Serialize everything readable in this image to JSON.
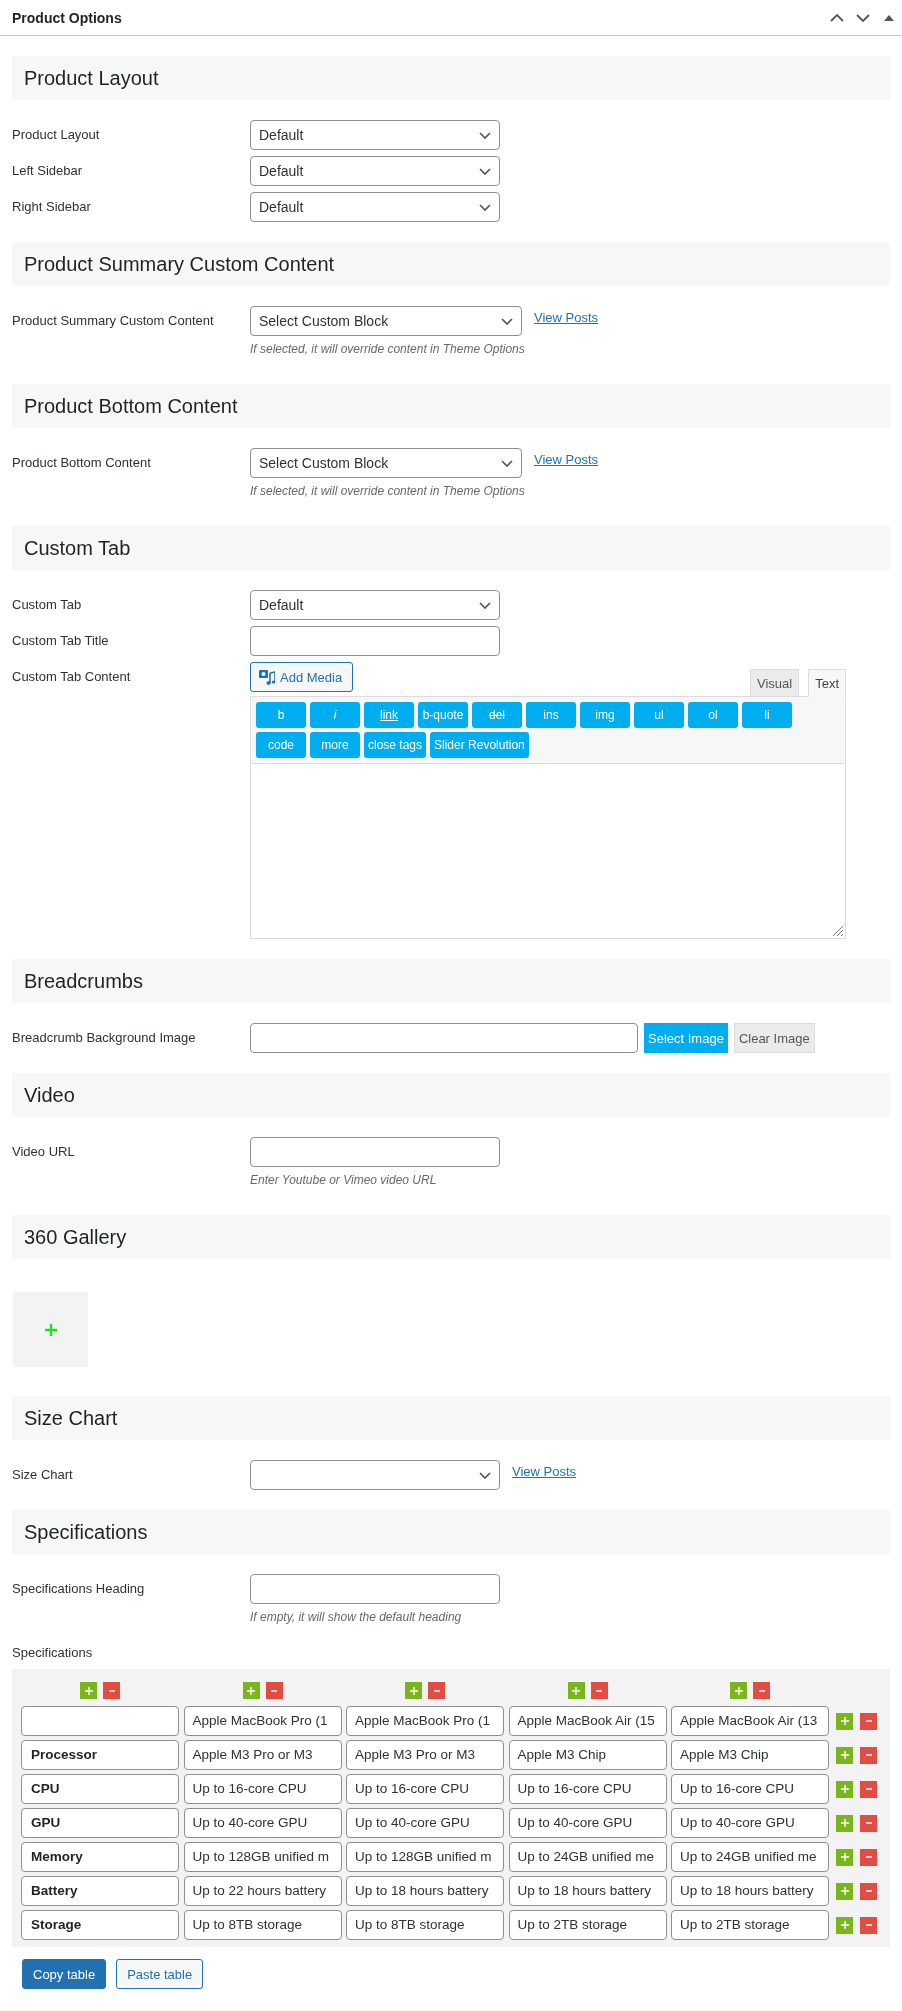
{
  "panel": {
    "title": "Product Options"
  },
  "sections": [
    {
      "title": "Product Layout",
      "fields": [
        {
          "kind": "select",
          "label": "Product Layout",
          "value": "Default"
        },
        {
          "kind": "select",
          "label": "Left Sidebar",
          "value": "Default"
        },
        {
          "kind": "select",
          "label": "Right Sidebar",
          "value": "Default"
        }
      ]
    },
    {
      "title": "Product Summary Custom Content",
      "fields": [
        {
          "kind": "select",
          "label": "Product Summary Custom Content",
          "value": "Select Custom Block",
          "link": "View Posts",
          "description": "If selected, it will override content in Theme Options"
        }
      ]
    },
    {
      "title": "Product Bottom Content",
      "fields": [
        {
          "kind": "select",
          "label": "Product Bottom Content",
          "value": "Select Custom Block",
          "link": "View Posts",
          "description": "If selected, it will override content in Theme Options"
        }
      ]
    },
    {
      "title": "Custom Tab",
      "fields": [
        {
          "kind": "select",
          "label": "Custom Tab",
          "value": "Default"
        },
        {
          "kind": "text",
          "label": "Custom Tab Title"
        },
        {
          "kind": "editor",
          "label": "Custom Tab Content",
          "media_button": "Add Media",
          "tabs": [
            {
              "label": "Visual",
              "selected": false
            },
            {
              "label": "Text",
              "selected": true
            }
          ],
          "quicktags": [
            {
              "label": "b",
              "kind": "plain"
            },
            {
              "label": "i",
              "kind": "italic"
            },
            {
              "label": "link",
              "kind": "underline"
            },
            {
              "label": "b-quote",
              "kind": "plain"
            },
            {
              "label": "del",
              "kind": "strike"
            },
            {
              "label": "ins",
              "kind": "plain"
            },
            {
              "label": "img",
              "kind": "plain"
            },
            {
              "label": "ul",
              "kind": "plain"
            },
            {
              "label": "ol",
              "kind": "plain"
            },
            {
              "label": "li",
              "kind": "plain"
            },
            {
              "label": "code",
              "kind": "plain"
            },
            {
              "label": "more",
              "kind": "plain"
            },
            {
              "label": "close tags",
              "kind": "plain"
            },
            {
              "label": "Slider Revolution",
              "kind": "plain"
            }
          ]
        }
      ]
    },
    {
      "title": "Breadcrumbs",
      "fields": [
        {
          "kind": "image",
          "label": "Breadcrumb Background Image",
          "buttons": [
            {
              "label": "Select Image",
              "kind": "primary"
            },
            {
              "label": "Clear Image",
              "kind": "secondary"
            }
          ]
        }
      ]
    },
    {
      "title": "Video",
      "fields": [
        {
          "kind": "text",
          "label": "Video URL",
          "description": "Enter Youtube or Vimeo video URL"
        }
      ]
    },
    {
      "title": "360 Gallery",
      "fields": [
        {
          "kind": "gallery"
        }
      ]
    },
    {
      "title": "Size Chart",
      "fields": [
        {
          "kind": "select",
          "label": "Size Chart",
          "link": "View Posts"
        }
      ]
    },
    {
      "title": "Specifications",
      "fields": [
        {
          "kind": "text",
          "label": "Specifications Heading",
          "description": "If empty, it will show the default heading"
        },
        {
          "kind": "table",
          "label": "Specifications",
          "columns": [
            "Apple MacBook Pro (1",
            "Apple MacBook Pro (1",
            "Apple MacBook Air (15",
            "Apple MacBook Air (13"
          ],
          "rows": [
            {
              "name": "Processor",
              "values": [
                "Apple M3 Pro or M3",
                "Apple M3 Pro or M3",
                "Apple M3 Chip",
                "Apple M3 Chip"
              ]
            },
            {
              "name": "CPU",
              "values": [
                "Up to 16-core CPU",
                "Up to 16-core CPU",
                "Up to 16-core CPU",
                "Up to 16-core CPU"
              ]
            },
            {
              "name": "GPU",
              "values": [
                "Up to 40-core GPU",
                "Up to 40-core GPU",
                "Up to 40-core GPU",
                "Up to 40-core GPU"
              ]
            },
            {
              "name": "Memory",
              "values": [
                "Up to 128GB unified m",
                "Up to 128GB unified m",
                "Up to 24GB unified me",
                "Up to 24GB unified me"
              ]
            },
            {
              "name": "Battery",
              "values": [
                "Up to 22 hours battery",
                "Up to 18 hours battery",
                "Up to 18 hours battery",
                "Up to 18 hours battery"
              ]
            },
            {
              "name": "Storage",
              "values": [
                "Up to 8TB storage",
                "Up to 8TB storage",
                "Up to 2TB storage",
                "Up to 2TB storage"
              ]
            }
          ],
          "buttons": [
            {
              "label": "Copy table",
              "kind": "primary"
            },
            {
              "label": "Paste table",
              "kind": "outline"
            }
          ]
        }
      ]
    }
  ]
}
